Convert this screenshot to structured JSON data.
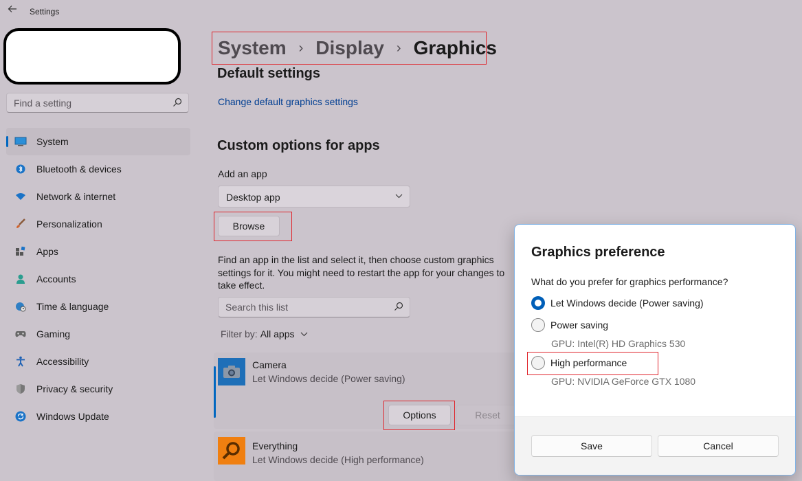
{
  "window": {
    "title": "Settings"
  },
  "search": {
    "placeholder": "Find a setting"
  },
  "sidebar": {
    "items": [
      {
        "label": "System",
        "icon": "system-icon",
        "active": true
      },
      {
        "label": "Bluetooth & devices",
        "icon": "bluetooth-icon"
      },
      {
        "label": "Network & internet",
        "icon": "wifi-icon"
      },
      {
        "label": "Personalization",
        "icon": "brush-icon"
      },
      {
        "label": "Apps",
        "icon": "apps-icon"
      },
      {
        "label": "Accounts",
        "icon": "person-icon"
      },
      {
        "label": "Time & language",
        "icon": "globe-clock-icon"
      },
      {
        "label": "Gaming",
        "icon": "gamepad-icon"
      },
      {
        "label": "Accessibility",
        "icon": "accessibility-icon"
      },
      {
        "label": "Privacy & security",
        "icon": "shield-icon"
      },
      {
        "label": "Windows Update",
        "icon": "update-icon"
      }
    ]
  },
  "breadcrumb": {
    "part1": "System",
    "part2": "Display",
    "current": "Graphics",
    "separator": "›"
  },
  "main": {
    "default_settings_title": "Default settings",
    "change_default_link": "Change default graphics settings",
    "custom_options_title": "Custom options for apps",
    "add_app_label": "Add an app",
    "app_type_selected": "Desktop app",
    "browse_label": "Browse",
    "help_text": "Find an app in the list and select it, then choose custom graphics settings for it. You might need to restart the app for your changes to take effect.",
    "list_search_placeholder": "Search this list",
    "filter_label": "Filter by:",
    "filter_value": "All apps",
    "apps": [
      {
        "name": "Camera",
        "setting": "Let Windows decide (Power saving)",
        "icon": "camera-icon"
      },
      {
        "name": "Everything",
        "setting": "Let Windows decide (High performance)",
        "icon": "magnifier-app-icon"
      }
    ],
    "options_label": "Options",
    "reset_label": "Reset"
  },
  "dialog": {
    "title": "Graphics preference",
    "question": "What do you prefer for graphics performance?",
    "options": [
      {
        "label": "Let Windows decide (Power saving)",
        "checked": true
      },
      {
        "label": "Power saving",
        "gpu": "GPU: Intel(R) HD Graphics 530",
        "checked": false
      },
      {
        "label": "High performance",
        "gpu": "GPU: NVIDIA GeForce GTX 1080",
        "checked": false
      }
    ],
    "save_label": "Save",
    "cancel_label": "Cancel"
  },
  "colors": {
    "accent": "#0067c0",
    "highlight_border": "#e0242b",
    "background": "#cbc4cc"
  }
}
